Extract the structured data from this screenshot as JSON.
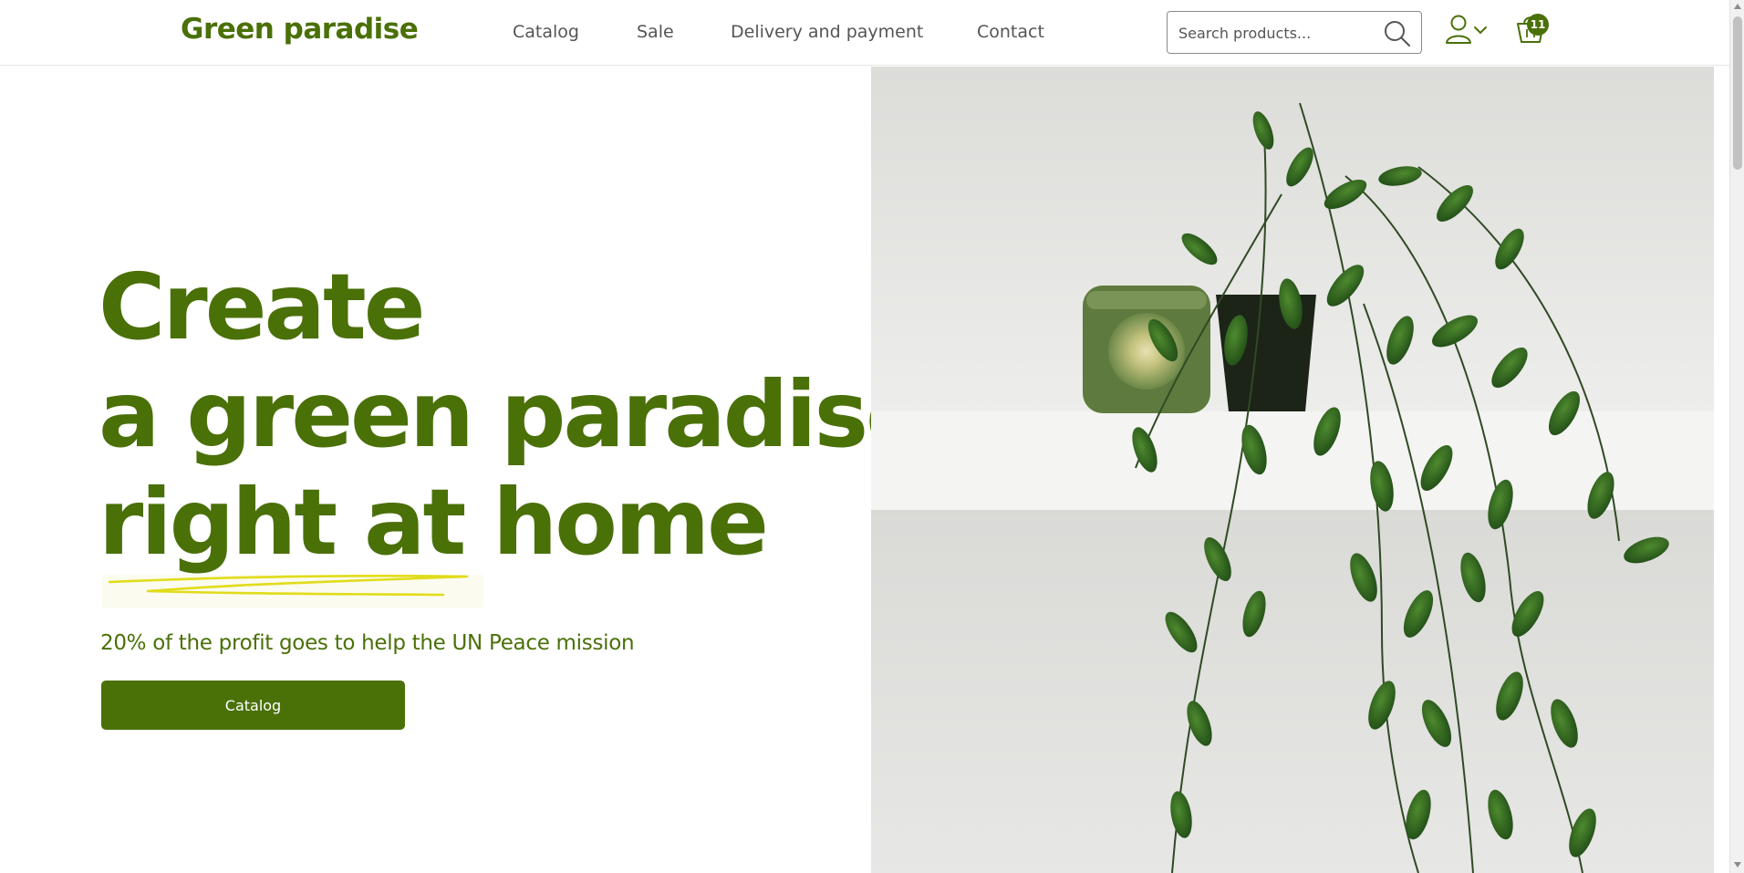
{
  "header": {
    "logo": "Green paradise",
    "nav": [
      {
        "label": "Catalog"
      },
      {
        "label": "Sale"
      },
      {
        "label": "Delivery and payment"
      },
      {
        "label": "Contact"
      }
    ],
    "search": {
      "placeholder": "Search products...",
      "icon": "search-icon"
    },
    "account": {
      "icon": "user-icon"
    },
    "cart": {
      "icon": "cart-icon",
      "count": "11"
    }
  },
  "hero": {
    "title_lines": [
      "Create",
      "a green paradise",
      "right at home"
    ],
    "subtitle": "20% of the profit goes to help the UN Peace mission",
    "cta_label": "Catalog",
    "image": "plant-photo"
  },
  "colors": {
    "brand": "#4a7008",
    "accent_scribble": "#e1dc1a",
    "nav_text": "#555555"
  }
}
